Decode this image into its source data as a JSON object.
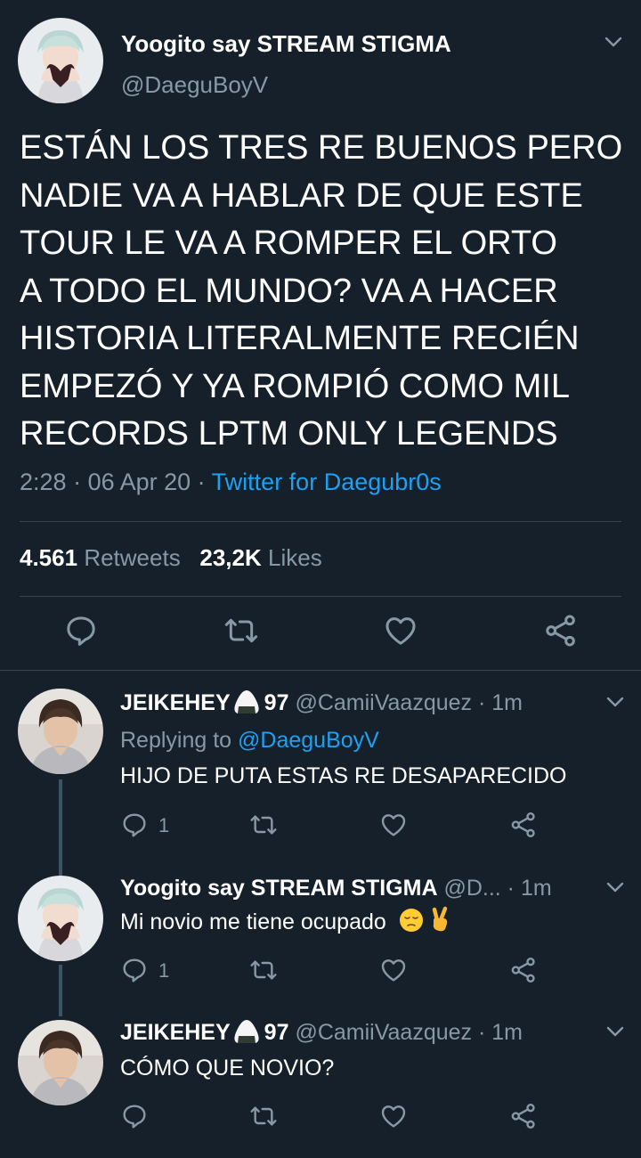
{
  "main_tweet": {
    "display_name": "Yoogito say STREAM STIGMA",
    "handle": "@DaeguBoyV",
    "text_lines": [
      "ESTÁN LOS TRES RE BUENOS PERO",
      "NADIE VA A HABLAR DE QUE ESTE",
      "TOUR LE VA A ROMPER EL ORTO",
      "A TODO EL MUNDO? VA A HACER",
      "HISTORIA LITERALMENTE RECIÉN",
      "EMPEZÓ Y YA ROMPIÓ COMO MIL",
      "RECORDS LPTM ONLY LEGENDS"
    ],
    "time": "2:28",
    "date": "06 Apr 20",
    "source": "Twitter for Daegubr0s",
    "retweets_count": "4.561",
    "retweets_label": "Retweets",
    "likes_count": "23,2K",
    "likes_label": "Likes"
  },
  "replies": [
    {
      "display_name": "JEIKEHEY",
      "name_suffix": "97",
      "handle": "@CamiiVaazquez",
      "time": "1m",
      "replying_to_label": "Replying to",
      "replying_to_handle": "@DaeguBoyV",
      "text": "HIJO DE PUTA ESTAS RE DESAPARECIDO",
      "reply_count": "1"
    },
    {
      "display_name": "Yoogito say STREAM STIGMA",
      "handle": "@D...",
      "time": "1m",
      "text": "Mi novio me tiene ocupado",
      "reply_count": "1"
    },
    {
      "display_name": "JEIKEHEY",
      "name_suffix": "97",
      "handle": "@CamiiVaazquez",
      "time": "1m",
      "text": "CÓMO QUE NOVIO?"
    }
  ],
  "separator": " · ",
  "colors": {
    "background": "#15202b",
    "divider": "#38444d",
    "muted_text": "#8899a6",
    "link": "#1da1f2",
    "thread_line": "#3d5466"
  },
  "icons": [
    "reply-icon",
    "retweet-icon",
    "like-icon",
    "share-icon",
    "chevron-down-icon",
    "onigiri-emoji",
    "pensive-emoji",
    "victory-hand-emoji"
  ]
}
